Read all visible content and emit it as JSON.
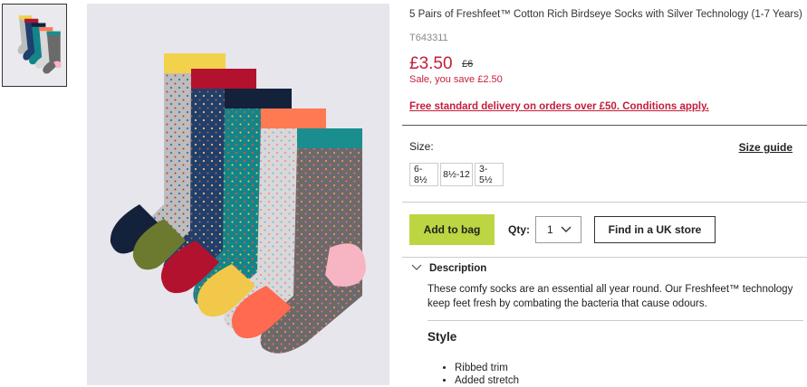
{
  "product": {
    "title": "5 Pairs of Freshfeet™ Cotton Rich Birdseye Socks with Silver Technology (1-7 Years)",
    "code": "T643311",
    "price": "£3.50",
    "was_price": "£6",
    "saving": "Sale, you save £2.50"
  },
  "delivery_link": "Free standard delivery on orders over £50. Conditions apply.",
  "size": {
    "label": "Size:",
    "guide": "Size guide",
    "options": [
      "6-8½",
      "8½-12",
      "3-5½"
    ]
  },
  "actions": {
    "add_to_bag": "Add to bag",
    "qty_label": "Qty:",
    "qty_value": "1",
    "find_store": "Find in a UK store"
  },
  "description": {
    "heading": "Description",
    "text": "These comfy socks are an essential all year round. Our Freshfeet™ technology keep feet fresh by combating the bacteria that cause odours."
  },
  "style": {
    "heading": "Style",
    "bullets": [
      "Ribbed trim",
      "Added stretch"
    ]
  },
  "colors": {
    "sale_red": "#c41e3a",
    "add_button": "#bcd542"
  },
  "icons": {
    "qty_chevron": "chevron-down-icon",
    "description_chevron": "chevron-down-icon"
  }
}
